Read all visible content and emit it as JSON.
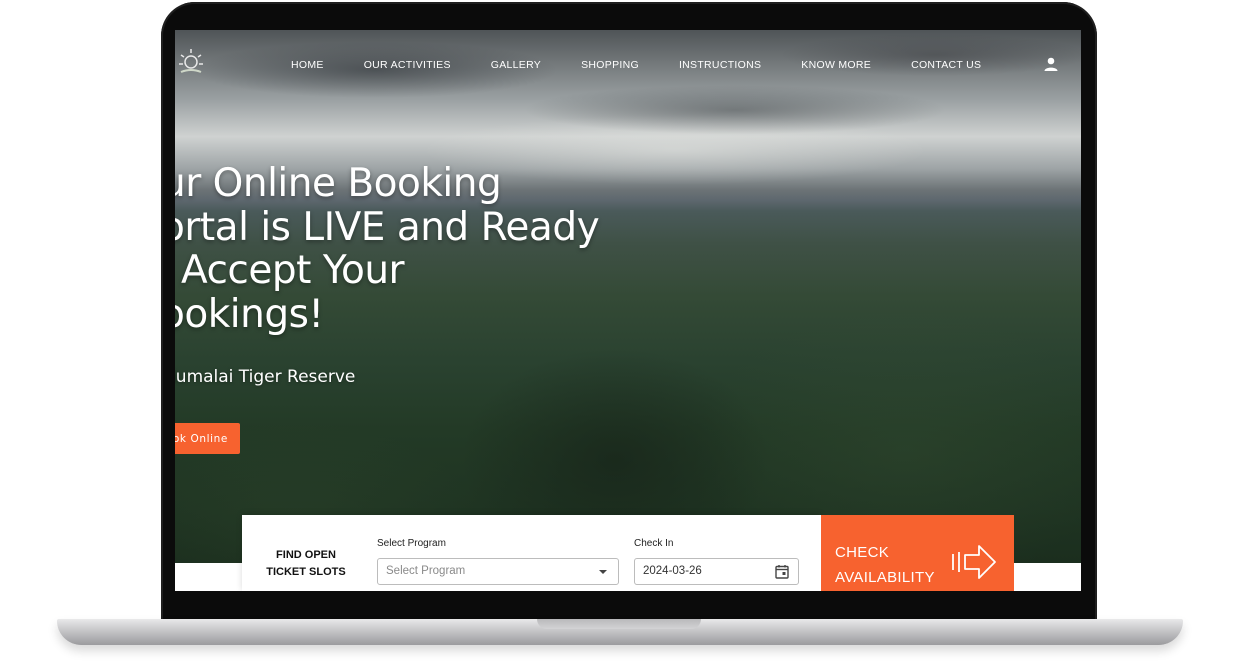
{
  "nav": {
    "items": [
      "HOME",
      "OUR ACTIVITIES",
      "GALLERY",
      "SHOPPING",
      "INSTRUCTIONS",
      "KNOW MORE",
      "CONTACT US"
    ]
  },
  "hero": {
    "headline_lines": [
      "ur Online Booking",
      "ortal is LIVE and Ready",
      "Accept Your",
      "ookings!"
    ],
    "headline_glyph": "",
    "subtitle": "dumalai Tiger Reserve",
    "cta_label": "ok Online"
  },
  "booking": {
    "find_label_line1": "FIND OPEN",
    "find_label_line2": "TICKET SLOTS",
    "program_label": "Select Program",
    "program_placeholder": "Select Program",
    "checkin_label": "Check In",
    "checkin_value": "2024-03-26",
    "check_line1": "CHECK",
    "check_line2": "AVAILABILITY"
  },
  "icons": {
    "logo": "sun-logo-icon",
    "user": "user-icon",
    "calendar": "calendar-icon",
    "arrow": "double-bar-arrow-icon"
  },
  "colors": {
    "accent": "#f7622f",
    "laptop_bezel": "#0b0b0b"
  }
}
